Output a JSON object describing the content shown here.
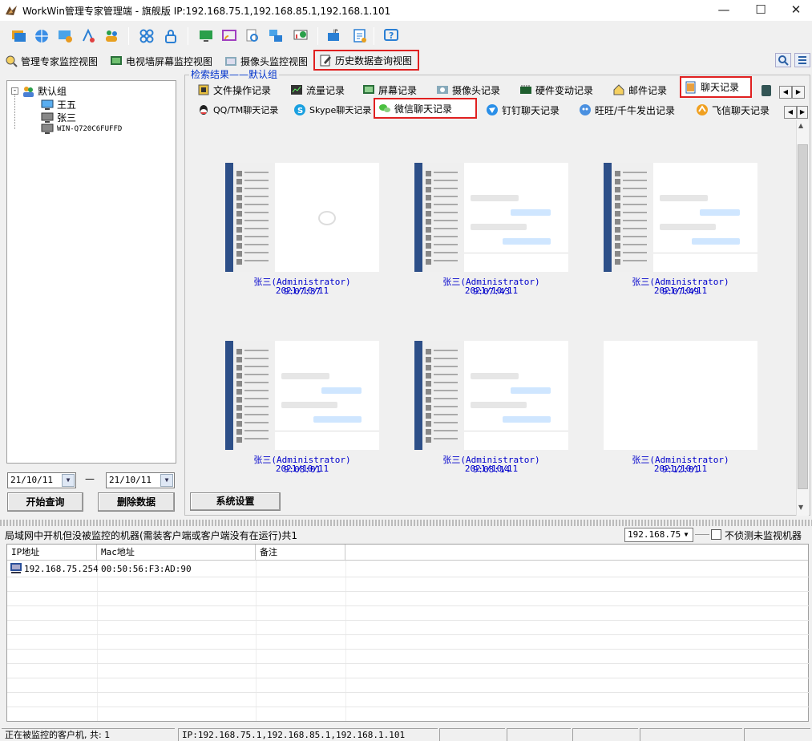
{
  "window": {
    "title": "WorkWin管理专家管理端 - 旗舰版 IP:192.168.75.1,192.168.85.1,192.168.1.101"
  },
  "view_tabs": [
    {
      "label": "管理专家监控视图"
    },
    {
      "label": "电视墙屏幕监控视图"
    },
    {
      "label": "摄像头监控视图"
    },
    {
      "label": "历史数据查询视图"
    }
  ],
  "tree": {
    "root": "默认组",
    "nodes": [
      "王五",
      "张三",
      "WIN-Q720C6FUFFD"
    ]
  },
  "query": {
    "start_date": "21/10/11",
    "end_date": "21/10/11",
    "separator": "—",
    "search_label": "开始查询",
    "delete_label": "删除数据"
  },
  "results": {
    "caption": "检索结果——默认组",
    "record_tabs": [
      "文件操作记录",
      "流量记录",
      "屏幕记录",
      "摄像头记录",
      "硬件变动记录",
      "邮件记录",
      "聊天记录"
    ],
    "chat_tabs": [
      "QQ/TM聊天记录",
      "Skype聊天记录",
      "微信聊天记录",
      "钉钉聊天记录",
      "旺旺/千牛发出记录",
      "飞信聊天记录"
    ],
    "thumbnails": [
      {
        "user": "张三(Administrator) 2021/10/11",
        "time": "9:07:37"
      },
      {
        "user": "张三(Administrator) 2021/10/11",
        "time": "9:07:43"
      },
      {
        "user": "张三(Administrator) 2021/10/11",
        "time": "9:07:49"
      },
      {
        "user": "张三(Administrator) 2021/10/11",
        "time": "9:08:01"
      },
      {
        "user": "张三(Administrator) 2021/10/11",
        "time": "9:08:14"
      },
      {
        "user": "张三(Administrator) 2021/10/11",
        "time": "9:12:01"
      }
    ],
    "settings_label": "系统设置"
  },
  "unmonitored": {
    "header": "局域网中开机但没被监控的机器(需装客户端或客户端没有在运行)共1",
    "subnet": "192.168.75",
    "no_detect_label": "不侦测未监视机器",
    "columns": [
      "IP地址",
      "Mac地址",
      "备注"
    ],
    "rows": [
      {
        "ip": "192.168.75.254",
        "mac": "00:50:56:F3:AD:90",
        "note": ""
      }
    ]
  },
  "status": {
    "monitored": "正在被监控的客户机, 共: 1",
    "ip": "IP:192.168.75.1,192.168.85.1,192.168.1.101"
  },
  "colors": {
    "highlight_box": "#e02020",
    "link_text": "#0000cc"
  }
}
